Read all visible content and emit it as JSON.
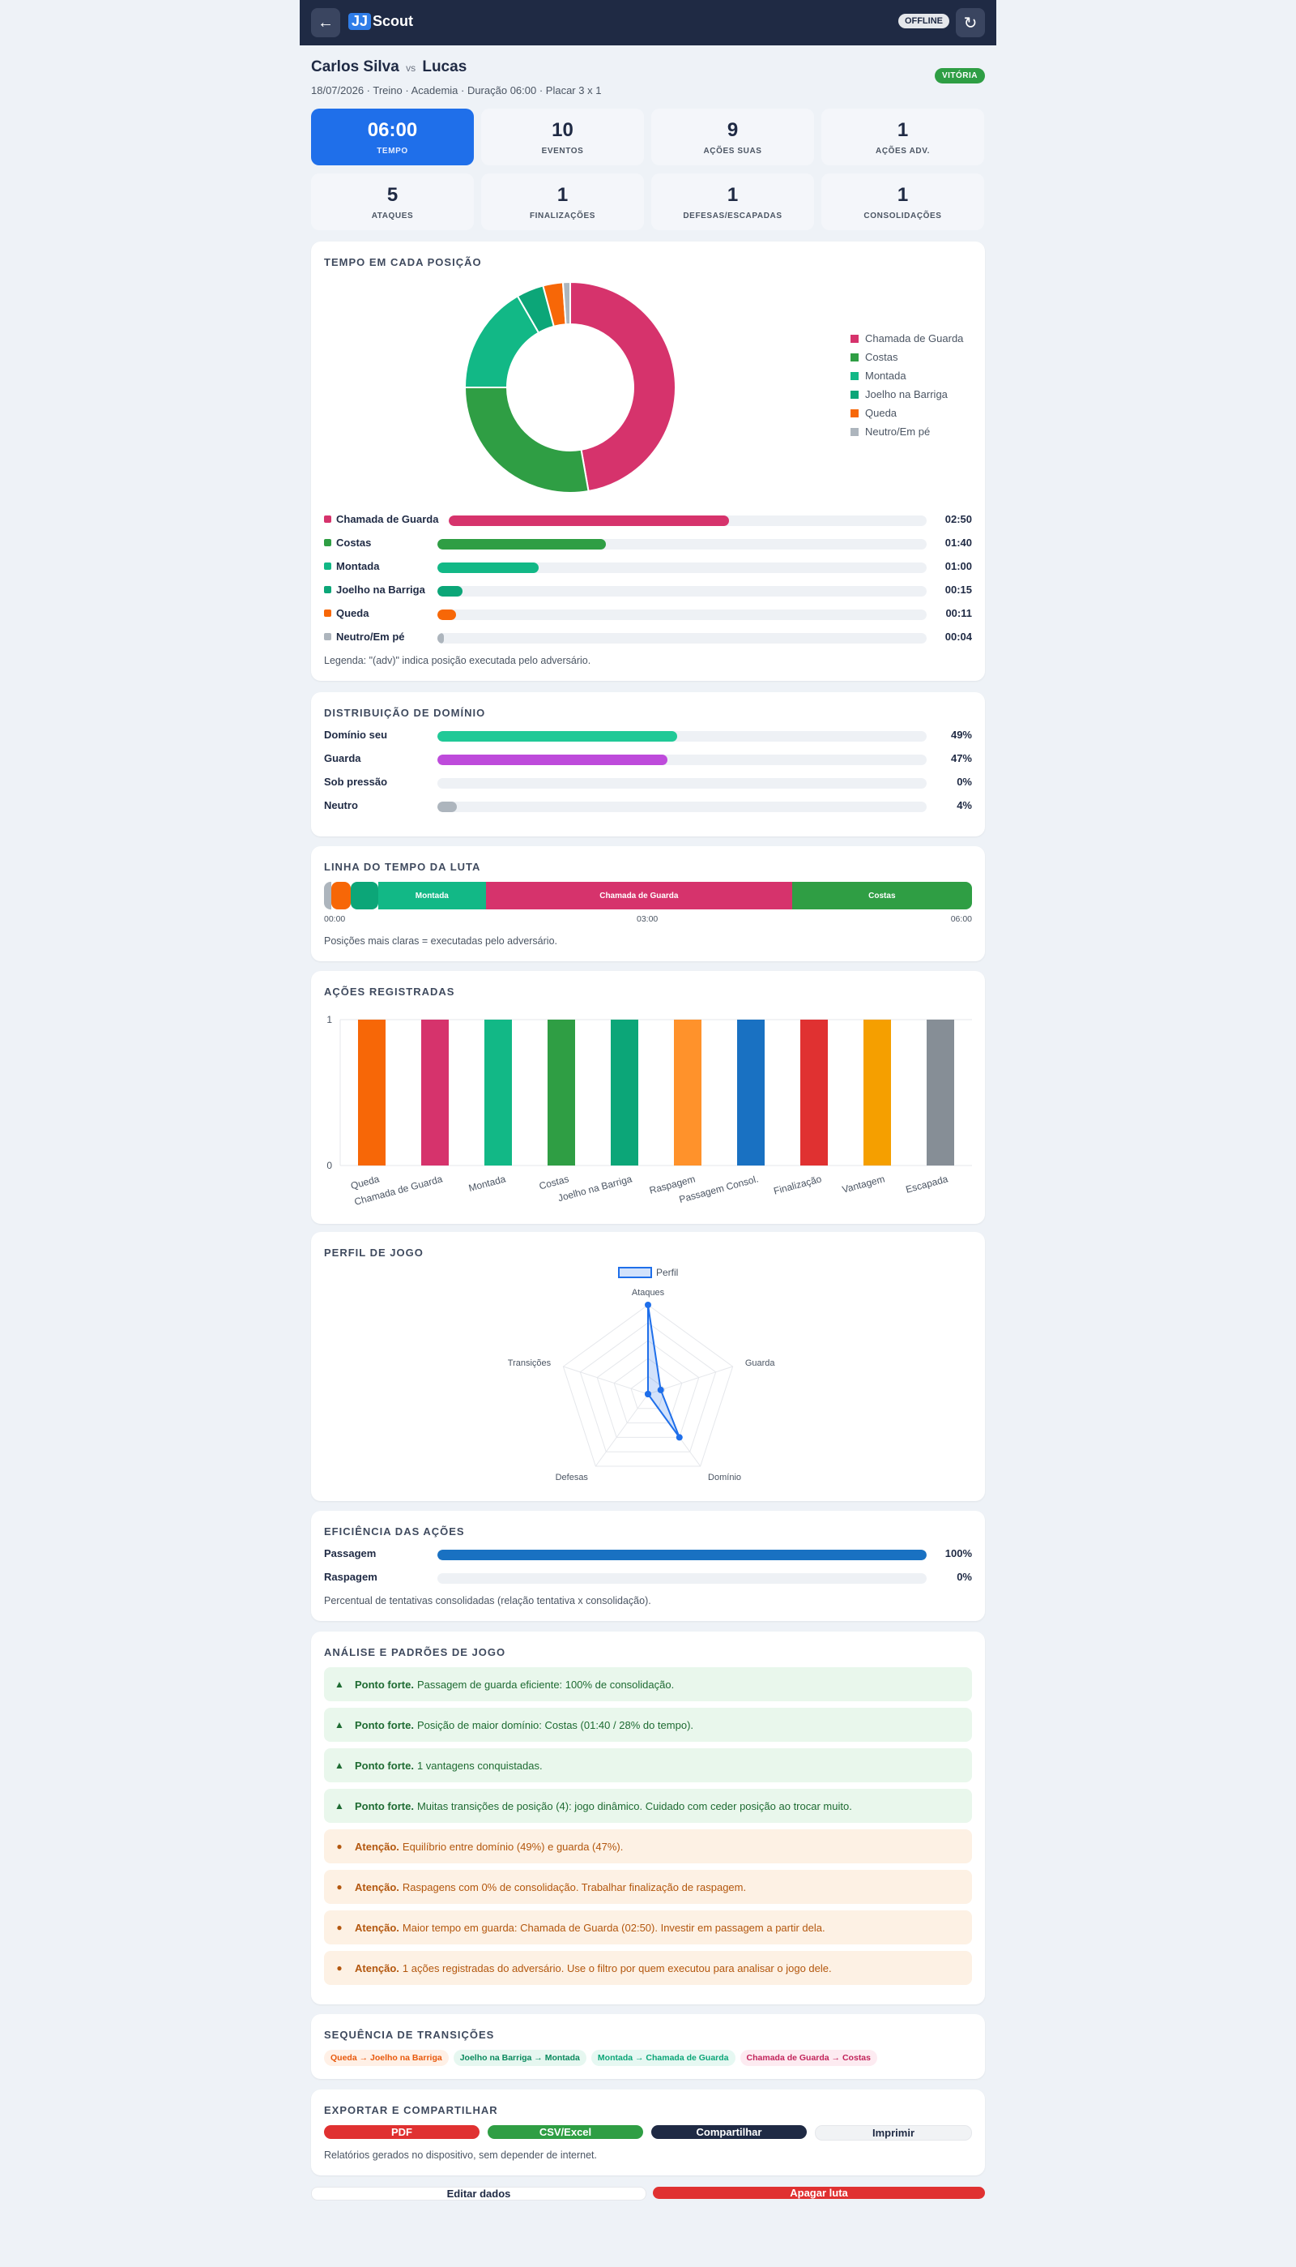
{
  "topbar": {
    "back_icon": "arrow-left-icon",
    "logo_badge": "JJ",
    "logo_text": "Scout",
    "offline_label": "OFFLINE",
    "refresh_icon": "refresh-icon"
  },
  "header": {
    "athlete": "Carlos Silva",
    "vs": "vs",
    "opponent": "Lucas",
    "subtitle": "18/07/2026 · Treino · Academia · Duração 06:00 · Placar 3 x 1",
    "result": "VITÓRIA"
  },
  "stats": [
    {
      "value": "06:00",
      "label": "TEMPO",
      "primary": true
    },
    {
      "value": "10",
      "label": "EVENTOS"
    },
    {
      "value": "9",
      "label": "AÇÕES SUAS"
    },
    {
      "value": "1",
      "label": "AÇÕES ADV."
    },
    {
      "value": "5",
      "label": "ATAQUES"
    },
    {
      "value": "1",
      "label": "FINALIZAÇÕES"
    },
    {
      "value": "1",
      "label": "DEFESAS/ESCAPADAS"
    },
    {
      "value": "1",
      "label": "CONSOLIDAÇÕES"
    }
  ],
  "position_time": {
    "title": "TEMPO EM CADA POSIÇÃO",
    "items": [
      {
        "name": "Chamada de Guarda",
        "time": "02:50",
        "seconds": 170,
        "color": "#d6336c"
      },
      {
        "name": "Costas",
        "time": "01:40",
        "seconds": 100,
        "color": "#2f9e44"
      },
      {
        "name": "Montada",
        "time": "01:00",
        "seconds": 60,
        "color": "#12b886"
      },
      {
        "name": "Joelho na Barriga",
        "time": "00:15",
        "seconds": 15,
        "color": "#0ca678"
      },
      {
        "name": "Queda",
        "time": "00:11",
        "seconds": 11,
        "color": "#f76707"
      },
      {
        "name": "Neutro/Em pé",
        "time": "00:04",
        "seconds": 4,
        "color": "#adb5bd"
      }
    ],
    "note": "Legenda: \"(adv)\" indica posição executada pelo adversário."
  },
  "domain": {
    "title": "DISTRIBUIÇÃO DE DOMÍNIO",
    "items": [
      {
        "name": "Domínio seu",
        "value": "49%",
        "pct": 49,
        "color": "#20c997"
      },
      {
        "name": "Guarda",
        "value": "47%",
        "pct": 47,
        "color": "#be4bdb"
      },
      {
        "name": "Sob pressão",
        "value": "0%",
        "pct": 0,
        "color": "#fa5252"
      },
      {
        "name": "Neutro",
        "value": "4%",
        "pct": 4,
        "color": "#adb5bd"
      }
    ]
  },
  "timeline": {
    "title": "LINHA DO TEMPO DA LUTA",
    "segments": [
      {
        "name": "Neutro/Em pé",
        "label": "",
        "seconds": 4,
        "color": "#adb5bd"
      },
      {
        "name": "Queda",
        "label": "",
        "seconds": 11,
        "color": "#f76707"
      },
      {
        "name": "Joelho na Barriga",
        "label": "",
        "seconds": 15,
        "color": "#0ca678"
      },
      {
        "name": "Montada",
        "label": "Montada",
        "seconds": 60,
        "color": "#12b886"
      },
      {
        "name": "Chamada de Guarda",
        "label": "Chamada de Guarda",
        "seconds": 170,
        "color": "#d6336c"
      },
      {
        "name": "Costas",
        "label": "Costas",
        "seconds": 100,
        "color": "#2f9e44"
      }
    ],
    "ticks": [
      "00:00",
      "03:00",
      "06:00"
    ],
    "note": "Posições mais claras = executadas pelo adversário."
  },
  "chart_data": [
    {
      "type": "bar",
      "title": "AÇÕES REGISTRADAS",
      "categories": [
        "Queda",
        "Chamada de Guarda",
        "Montada",
        "Costas",
        "Joelho na Barriga",
        "Raspagem",
        "Passagem Consol.",
        "Finalização",
        "Vantagem",
        "Escapada"
      ],
      "values": [
        1,
        1,
        1,
        1,
        1,
        1,
        1,
        1,
        1,
        1
      ],
      "colors": [
        "#f76707",
        "#d6336c",
        "#12b886",
        "#2f9e44",
        "#0ca678",
        "#ff922b",
        "#1971c2",
        "#e03131",
        "#f59f00",
        "#868e96"
      ],
      "ylim": [
        0,
        1
      ],
      "yticks": [
        "0",
        "1"
      ],
      "grid": true
    },
    {
      "type": "radar",
      "title": "PERFIL DE JOGO",
      "legend": "Perfil",
      "axes": [
        "Ataques",
        "Guarda",
        "Domínio",
        "Defesas",
        "Transições"
      ],
      "values": [
        1.0,
        0.15,
        0.6,
        0.0,
        0.0
      ],
      "rmax": 1,
      "color": "#1f6fea"
    }
  ],
  "efficiency": {
    "title": "EFICIÊNCIA DAS AÇÕES",
    "items": [
      {
        "name": "Passagem",
        "value": "100%",
        "pct": 100,
        "color": "#1971c2"
      },
      {
        "name": "Raspagem",
        "value": "0%",
        "pct": 0,
        "color": "#1971c2"
      }
    ],
    "note": "Percentual de tentativas consolidadas (relação tentativa x consolidação)."
  },
  "analysis": {
    "title": "ANÁLISE E PADRÕES DE JOGO",
    "items": [
      {
        "kind": "good",
        "icon": "▲",
        "label": "Ponto forte.",
        "text": "Passagem de guarda eficiente: 100% de consolidação."
      },
      {
        "kind": "good",
        "icon": "▲",
        "label": "Ponto forte.",
        "text": "Posição de maior domínio: Costas (01:40 / 28% do tempo)."
      },
      {
        "kind": "good",
        "icon": "▲",
        "label": "Ponto forte.",
        "text": "1 vantagens conquistadas."
      },
      {
        "kind": "good",
        "icon": "▲",
        "label": "Ponto forte.",
        "text": "Muitas transições de posição (4): jogo dinâmico. Cuidado com ceder posição ao trocar muito."
      },
      {
        "kind": "warn",
        "icon": "●",
        "label": "Atenção.",
        "text": "Equilíbrio entre domínio (49%) e guarda (47%)."
      },
      {
        "kind": "warn",
        "icon": "●",
        "label": "Atenção.",
        "text": "Raspagens com 0% de consolidação. Trabalhar finalização de raspagem."
      },
      {
        "kind": "warn",
        "icon": "●",
        "label": "Atenção.",
        "text": "Maior tempo em guarda: Chamada de Guarda (02:50). Investir em passagem a partir dela."
      },
      {
        "kind": "warn",
        "icon": "●",
        "label": "Atenção.",
        "text": "1 ações registradas do adversário. Use o filtro por quem executou para analisar o jogo dele."
      }
    ]
  },
  "transitions": {
    "title": "SEQUÊNCIA DE TRANSIÇÕES",
    "items": [
      {
        "text": "Queda → Joelho na Barriga",
        "bg": "#fff0e6",
        "fg": "#e8590c"
      },
      {
        "text": "Joelho na Barriga → Montada",
        "bg": "#e6f7f0",
        "fg": "#0b8a5e"
      },
      {
        "text": "Montada → Chamada de Guarda",
        "bg": "#e6f8f2",
        "fg": "#0ca678"
      },
      {
        "text": "Chamada de Guarda → Costas",
        "bg": "#fdebf1",
        "fg": "#c2255c"
      }
    ]
  },
  "export": {
    "title": "EXPORTAR E COMPARTILHAR",
    "buttons": [
      {
        "label": "PDF",
        "bg": "#e03131",
        "fg": "#ffffff"
      },
      {
        "label": "CSV/Excel",
        "bg": "#2f9e44",
        "fg": "#ffffff"
      },
      {
        "label": "Compartilhar",
        "bg": "#1f2a44",
        "fg": "#ffffff"
      },
      {
        "label": "Imprimir",
        "bg": "#f1f3f5",
        "fg": "#1f2a44"
      }
    ],
    "note": "Relatórios gerados no dispositivo, sem depender de internet."
  },
  "footer": {
    "edit_label": "Editar dados",
    "delete_label": "Apagar luta"
  }
}
